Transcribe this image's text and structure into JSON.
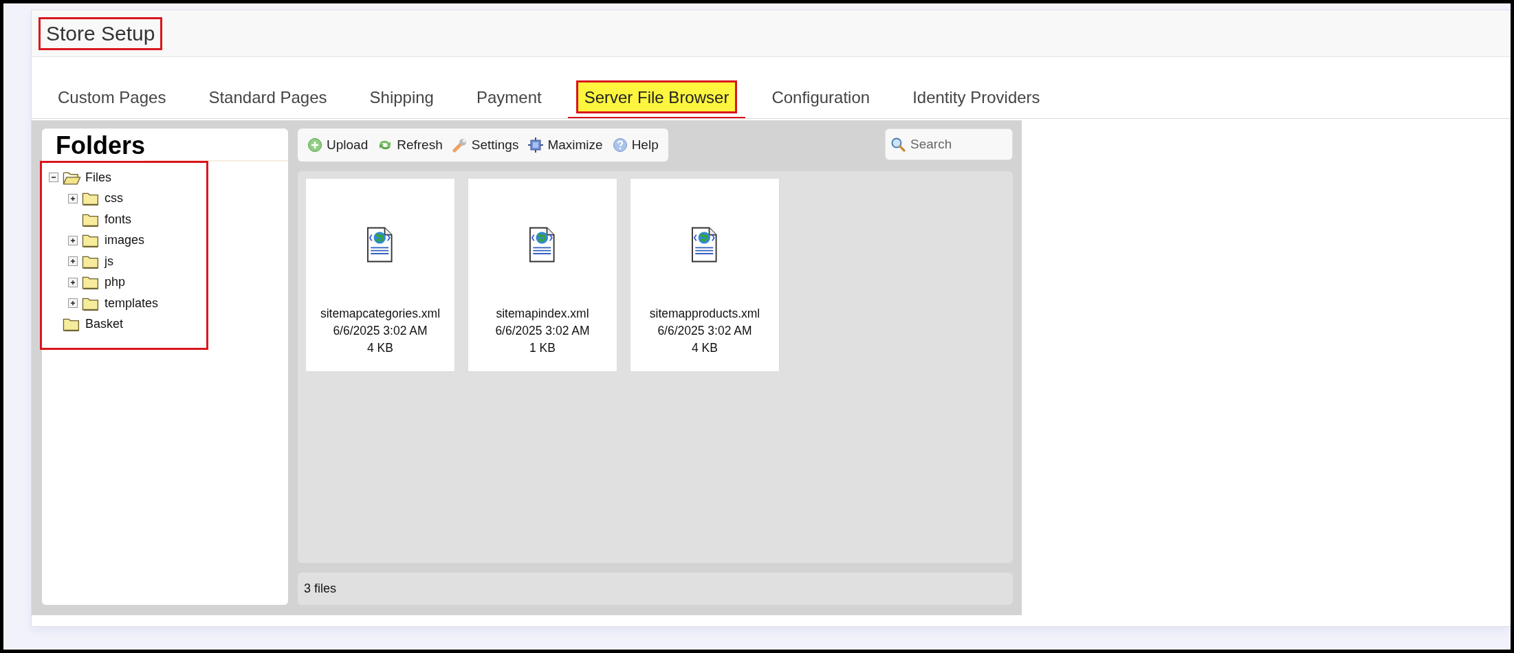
{
  "header": {
    "title": "Store Setup",
    "highlighted": true
  },
  "tabs": [
    {
      "label": "Custom Pages",
      "selected": false,
      "highlighted": false
    },
    {
      "label": "Standard Pages",
      "selected": false,
      "highlighted": false
    },
    {
      "label": "Shipping",
      "selected": false,
      "highlighted": false
    },
    {
      "label": "Payment",
      "selected": false,
      "highlighted": false
    },
    {
      "label": "Server File Browser",
      "selected": true,
      "highlighted": true
    },
    {
      "label": "Configuration",
      "selected": false,
      "highlighted": false
    },
    {
      "label": "Identity Providers",
      "selected": false,
      "highlighted": false
    }
  ],
  "folders_panel": {
    "heading": "Folders",
    "highlighted": true,
    "tree": [
      {
        "label": "Files",
        "expandable": true,
        "expanded": true,
        "children": [
          {
            "label": "css",
            "expandable": true,
            "expanded": false
          },
          {
            "label": "fonts",
            "expandable": false,
            "expanded": false
          },
          {
            "label": "images",
            "expandable": true,
            "expanded": false
          },
          {
            "label": "js",
            "expandable": true,
            "expanded": false
          },
          {
            "label": "php",
            "expandable": true,
            "expanded": false
          },
          {
            "label": "templates",
            "expandable": true,
            "expanded": false
          }
        ]
      },
      {
        "label": "Basket",
        "expandable": false,
        "expanded": false
      }
    ]
  },
  "toolbar": [
    {
      "kind": "upload",
      "label": "Upload"
    },
    {
      "kind": "refresh",
      "label": "Refresh"
    },
    {
      "kind": "settings",
      "label": "Settings"
    },
    {
      "kind": "maximize",
      "label": "Maximize"
    },
    {
      "kind": "help",
      "label": "Help"
    }
  ],
  "search": {
    "placeholder": "Search"
  },
  "files": [
    {
      "name": "sitemapcategories.xml",
      "date": "6/6/2025 3:02 AM",
      "size": "4 KB"
    },
    {
      "name": "sitemapindex.xml",
      "date": "6/6/2025 3:02 AM",
      "size": "1 KB"
    },
    {
      "name": "sitemapproducts.xml",
      "date": "6/6/2025 3:02 AM",
      "size": "4 KB"
    }
  ],
  "status_bar": "3 files"
}
